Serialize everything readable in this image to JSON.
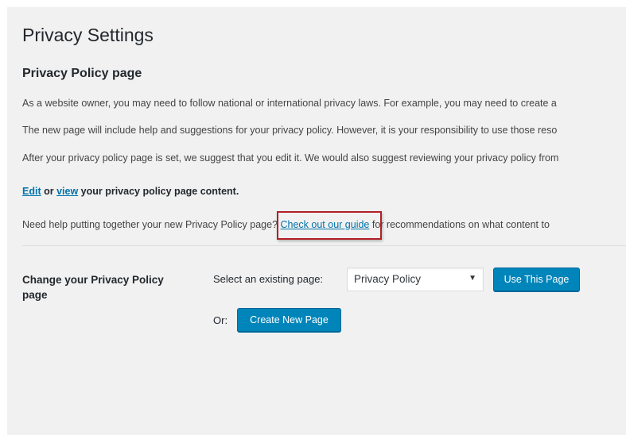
{
  "page": {
    "title": "Privacy Settings",
    "section_title": "Privacy Policy page"
  },
  "paragraphs": {
    "p1": "As a website owner, you may need to follow national or international privacy laws. For example, you may need to create a",
    "p2": "The new page will include help and suggestions for your privacy policy. However, it is your responsibility to use those reso",
    "p3": "After your privacy policy page is set, we suggest that you edit it. We would also suggest reviewing your privacy policy from",
    "p4": {
      "edit_link": "Edit",
      "or_text": " or ",
      "view_link": "view",
      "rest": " your privacy policy page content."
    },
    "p5": {
      "before": "Need help putting together your new Privacy Policy page? ",
      "guide_link": "Check out our guide",
      "after": " for recommendations on what content to"
    }
  },
  "form": {
    "label": "Change your Privacy Policy page",
    "select_label": "Select an existing page:",
    "select_value": "Privacy Policy",
    "select_arrow": "▼",
    "use_button": "Use This Page",
    "or_label": "Or:",
    "create_button": "Create New Page"
  },
  "colors": {
    "background": "#f1f1f1",
    "link": "#0073aa",
    "primary_button": "#0085ba",
    "highlight_box": "#b22026"
  }
}
